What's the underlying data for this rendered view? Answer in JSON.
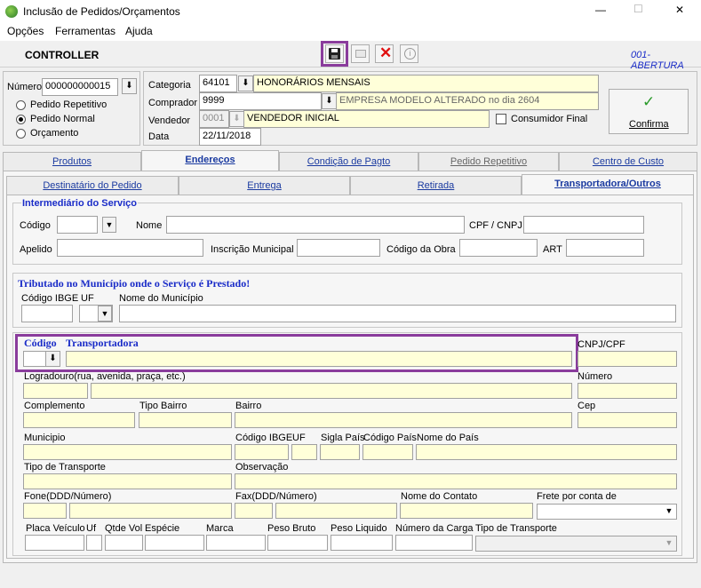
{
  "window": {
    "title": "Inclusão de Pedidos/Orçamentos",
    "minimize": "—",
    "maximize": "☐",
    "close": "✕"
  },
  "menu": [
    "Opções",
    "Ferramentas",
    "Ajuda"
  ],
  "toolbar": {
    "title": "CONTROLLER",
    "status": "001-ABERTURA"
  },
  "order": {
    "numero_label": "Número",
    "numero_value": "000000000015",
    "options": [
      "Pedido Repetitivo",
      "Pedido Normal",
      "Orçamento"
    ]
  },
  "header": {
    "categoria_label": "Categoria",
    "categoria_code": "64101",
    "categoria_desc": "HONORÁRIOS MENSAIS",
    "comprador_label": "Comprador",
    "comprador_code": "9999",
    "comprador_desc": "EMPRESA MODELO ALTERADO no dia 2604",
    "vendedor_label": "Vendedor",
    "vendedor_code": "0001",
    "vendedor_desc": "VENDEDOR INICIAL",
    "data_label": "Data",
    "data_value": "22/11/2018",
    "consumidor_final": "Consumidor Final",
    "confirma": "Confirma"
  },
  "tabs": [
    "Produtos",
    "Endereços",
    "Condição de Pagto",
    "Pedido Repetitivo",
    "Centro de Custo"
  ],
  "subtabs": [
    "Destinatário do Pedido",
    "Entrega",
    "Retirada",
    "Transportadora/Outros"
  ],
  "intermediario": {
    "title": "Intermediário do Serviço",
    "codigo": "Código",
    "nome": "Nome",
    "cpf_cnpj": "CPF / CNPJ",
    "apelido": "Apelido",
    "inscricao": "Inscrição Municipal",
    "codigo_obra": "Código da Obra",
    "art": "ART"
  },
  "tributado": {
    "title": "Tributado no Município onde o Serviço é Prestado!",
    "codigo_ibge": "Código IBGE",
    "uf": "UF",
    "nome_municipio": "Nome do Município"
  },
  "transportadora": {
    "codigo": "Código",
    "transportadora": "Transportadora",
    "cnpj_cpf": "CNPJ/CPF",
    "logradouro": "Logradouro(rua, avenida, praça, etc.)",
    "numero": "Número",
    "complemento": "Complemento",
    "tipo_bairro": "Tipo Bairro",
    "bairro": "Bairro",
    "cep": "Cep",
    "municipio": "Municipio",
    "codigo_ibge": "Código IBGE",
    "uf": "UF",
    "sigla_pais": "Sigla País",
    "codigo_pais": "Código País",
    "nome_pais": "Nome do País",
    "tipo_transporte": "Tipo de Transporte",
    "observacao": "Observação",
    "fone": "Fone(DDD/Número)",
    "fax": "Fax(DDD/Número)",
    "nome_contato": "Nome do Contato",
    "frete": "Frete por conta de",
    "placa": "Placa Veículo",
    "uf2": "Uf",
    "qtde_vol": "Qtde Vol",
    "especie": "Espécie",
    "marca": "Marca",
    "peso_bruto": "Peso Bruto",
    "peso_liquido": "Peso Liquido",
    "numero_carga": "Número da Carga",
    "tipo_transporte2": "Tipo de Transporte"
  },
  "colors": {
    "highlight": "#8a3c9c",
    "accent_blue": "#1a2cc8",
    "field_yellow": "#ffffd9"
  }
}
